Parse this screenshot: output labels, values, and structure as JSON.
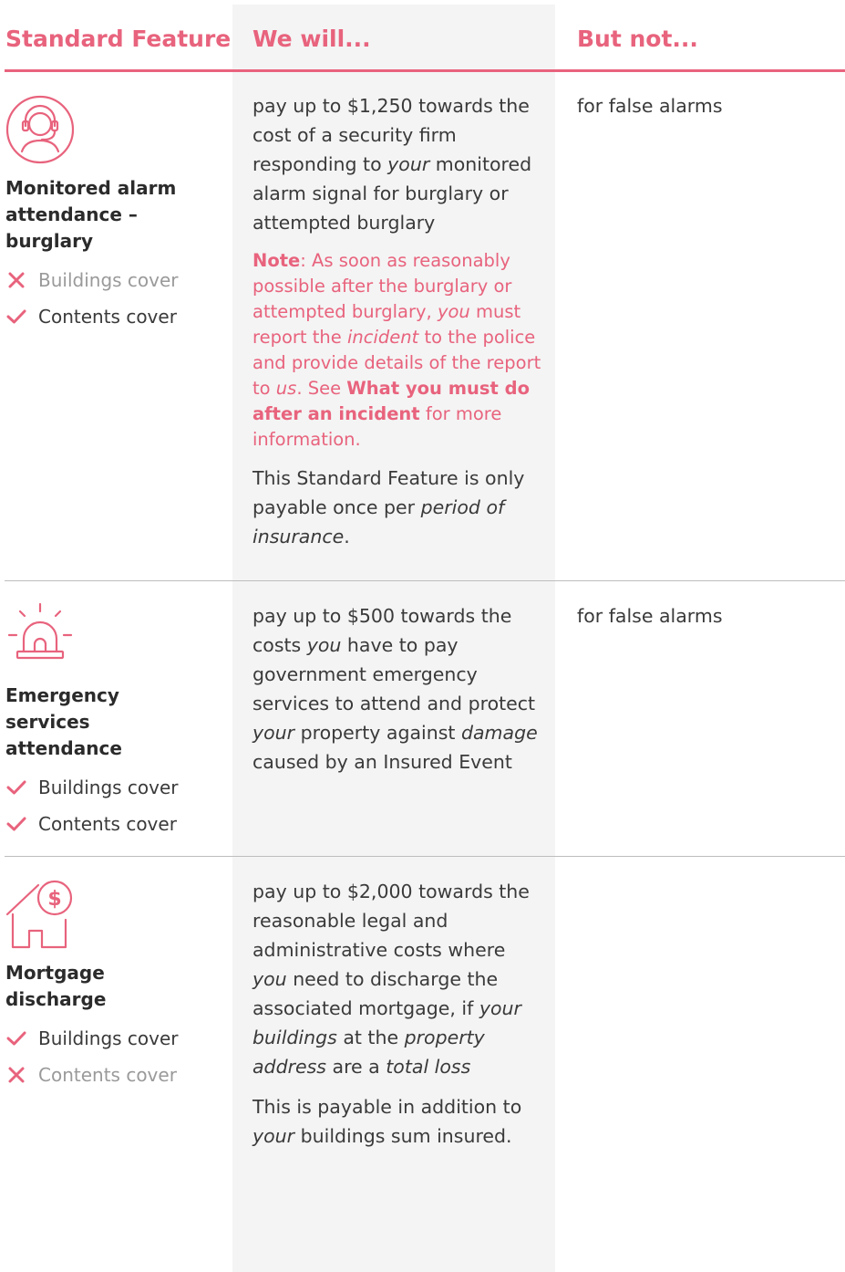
{
  "header": {
    "col1": "Standard Feature",
    "col2": "We will...",
    "col3": "But not..."
  },
  "colors": {
    "accent": "#e8637d",
    "middle_bg": "#f4f4f4",
    "rule": "#bdbdbd"
  },
  "rows": [
    {
      "icon": "headset-agent-icon",
      "title": "Monitored alarm attendance – burglary",
      "covers": [
        {
          "label": "Buildings cover",
          "included": false
        },
        {
          "label": "Contents cover",
          "included": true
        }
      ],
      "will": {
        "p1_a": "pay up to $1,250 towards the cost of a security firm responding to ",
        "p1_em": "your",
        "p1_b": " monitored alarm signal for burglary or attempted burglary",
        "note_label": "Note",
        "note_a": ": As soon as reasonably possible after the burglary or attempted burglary, ",
        "note_em1": "you",
        "note_b": " must report the ",
        "note_em2": "incident",
        "note_c": " to the police and provide details of the report to ",
        "note_em3": "us",
        "note_d": ". See ",
        "note_bold": "What you must do after an incident",
        "note_e": " for more information.",
        "p3_a": "This Standard Feature is only payable once per ",
        "p3_em": "period of insurance",
        "p3_b": "."
      },
      "but_not": "for false alarms"
    },
    {
      "icon": "siren-icon",
      "title": "Emergency services attendance",
      "covers": [
        {
          "label": "Buildings cover",
          "included": true
        },
        {
          "label": "Contents cover",
          "included": true
        }
      ],
      "will": {
        "a": "pay up to $500 towards the costs ",
        "em1": "you",
        "b": " have to pay government emergency services to attend and protect ",
        "em2": "your",
        "c": " property against ",
        "em3": "damage",
        "d": " caused by an Insured Event"
      },
      "but_not": "for false alarms"
    },
    {
      "icon": "house-dollar-icon",
      "title": "Mortgage discharge",
      "covers": [
        {
          "label": "Buildings cover",
          "included": true
        },
        {
          "label": "Contents cover",
          "included": false
        }
      ],
      "will": {
        "a": "pay up to $2,000 towards the reasonable legal and administrative costs where ",
        "em1": "you",
        "b": " need to discharge the associated mortgage, if ",
        "em2": "your buildings",
        "c": " at the ",
        "em3": "property address",
        "d": " are a ",
        "em4": "total loss",
        "p2_em": "your",
        "p2_a": "This is payable in addition to ",
        "p2_b": " buildings sum insured."
      },
      "but_not": ""
    }
  ]
}
